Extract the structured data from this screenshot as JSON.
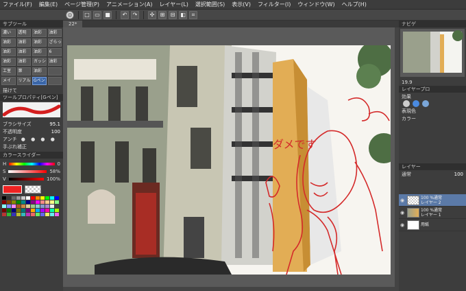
{
  "menu": [
    "ファイル(F)",
    "編集(E)",
    "ページ管理(P)",
    "アニメーション(A)",
    "レイヤー(L)",
    "選択範囲(S)",
    "表示(V)",
    "フィルター(I)",
    "ウィンドウ(W)",
    "ヘルプ(H)"
  ],
  "toolbar": {
    "icons": [
      "app-logo-icon",
      "new-icon",
      "open-icon",
      "save-icon",
      "undo-icon",
      "redo-icon",
      "transform-icon",
      "select-icon",
      "deselect-icon",
      "invert-icon",
      "crop-icon"
    ]
  },
  "left": {
    "subtool_header": "サブツール",
    "subtools": [
      "濃い",
      "透明",
      "油彩",
      "油彩",
      "油彩",
      "油彩",
      "油彩",
      "ざらっ",
      "油彩",
      "油彩",
      "油彩",
      "6",
      "油彩",
      "油彩",
      "ガッシ",
      "油彩",
      "工室",
      "第",
      "油彩",
      "",
      "メイ",
      "リアル",
      "Gペン",
      ""
    ],
    "drawing_label": "描けて",
    "toolprop_header": "ツールプロパティ[Gペン]",
    "brush_size_label": "ブラシサイズ",
    "brush_size_value": "95.1",
    "opacity_label": "不透明度",
    "opacity_value": "100",
    "antialias_label": "アンチ",
    "stab_label": "手ぶれ補正",
    "color_slider_header": "カラースライダー",
    "h_label": "H",
    "h_value": "0",
    "s_label": "S",
    "s_value": "58%",
    "v_label": "V",
    "v_value": "100%",
    "current_color": "#ee2222"
  },
  "canvas": {
    "tab_label": "22*",
    "annotation_text": "ダメです"
  },
  "right": {
    "navigator_header": "ナビゲ",
    "zoom_value": "19.9",
    "layer_prop_header": "レイヤープロ",
    "effect_label": "効果",
    "expression_label": "表現色",
    "expression_value": "カラー",
    "layer_header": "レイヤー",
    "blend_mode": "通常",
    "blend_value": "100",
    "layers": [
      {
        "line1": "100 %通常",
        "line2": "レイヤー 2"
      },
      {
        "line1": "100 %通常",
        "line2": "レイヤー 1"
      },
      {
        "line1": "",
        "line2": "用紙"
      }
    ]
  }
}
